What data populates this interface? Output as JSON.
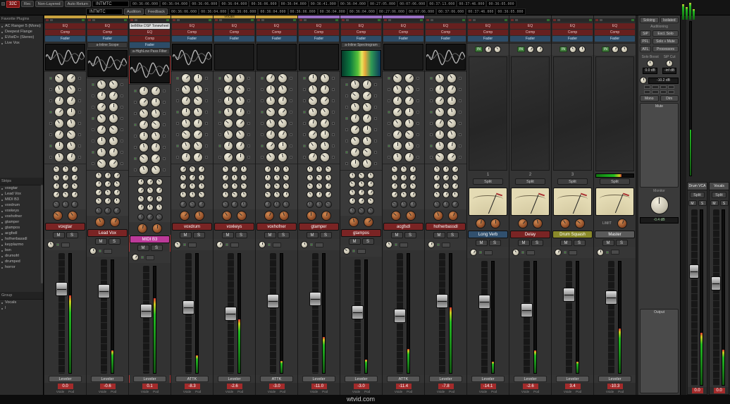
{
  "watermark": "wtvid.com",
  "topbar": {
    "logo": "32C",
    "rec": "Rec",
    "layer_mode": "Non-Layered",
    "auto_return": "Auto Return",
    "display1": "INTMTC",
    "display2": "INTMTC",
    "audition": "Audition",
    "feedback": "Feedback",
    "timecodes_row1": [
      "00:36:06.000",
      "00:36:04.000",
      "00:36:06.000",
      "00:36:04.000",
      "00:36:06.000",
      "00:36:04.000",
      "00:36:41.000",
      "00:36:04.000",
      "00:27:05.000",
      "00:07:06.000",
      "00:37:13.000",
      "00:37:46.000",
      "00:36:05.000"
    ],
    "timecodes_row2": [
      "00:36:06.000",
      "00:36:04.000",
      "00:36:06.000",
      "00:36:04.000",
      "00:36:06.000",
      "00:36:04.000",
      "00:36:04.000",
      "00:27:06.000",
      "00:07:06.000",
      "00:37:06.000",
      "00:37:46.000",
      "00:36:05.000"
    ]
  },
  "sidebar": {
    "plugins_title": "Favorite Plugins",
    "plugins": [
      "AC Ranger 5 (Mono)",
      "Deepest Flange",
      "EVistD+ (Stereo)",
      "Live Vox"
    ],
    "strips_title": "Strips",
    "strip_items": [
      "voxgtar",
      "Lead Vox",
      "MIDI B3",
      "voxdrum",
      "voxkeys",
      "voxhofner",
      "gtamper",
      "gtampos",
      "acgfsdl",
      "hofnerbassdl",
      "keyplazmo",
      "bsn",
      "drumofrl",
      "drumped",
      "horror"
    ],
    "groups_title": "Group",
    "group_items": [
      "Vocals",
      "I"
    ]
  },
  "group_label": "Vocals",
  "labels": {
    "mute": "M",
    "solo": "S",
    "split": "Split",
    "in": "IN",
    "limit": "LIMIT",
    "meta1": "Vside",
    "meta2": "Pod"
  },
  "strips": [
    {
      "name": "voxgtar",
      "type": "channel",
      "tab": "#c9a23f",
      "name_bg": "#7a2424",
      "slots": [
        {
          "label": "EQ",
          "kind": "red"
        },
        {
          "label": "Comp",
          "kind": "red"
        },
        {
          "label": "Fader",
          "kind": "blue"
        }
      ],
      "display": "waveform",
      "btn": "Leveler",
      "value": "0.0",
      "fader": 0.3,
      "meter": 0.65
    },
    {
      "name": "Lead Vox",
      "type": "channel",
      "tab": "#c9a23f",
      "name_bg": "#7a2424",
      "slots": [
        {
          "label": "EQ",
          "kind": "red"
        },
        {
          "label": "Comp",
          "kind": "red"
        },
        {
          "label": "Fader",
          "kind": "blue"
        },
        {
          "label": "a-Inline Scope",
          "kind": "plain"
        }
      ],
      "display": "waveform",
      "btn": "Leveler",
      "value": "-0.6",
      "fader": 0.28,
      "meter": 0.2
    },
    {
      "name": "MIDI B3",
      "type": "channel",
      "selected": true,
      "tab": "#c9a23f",
      "name_bg": "#bc3a9a",
      "slots": [
        {
          "label": "belMike DSP Tonewheel",
          "kind": "white"
        },
        {
          "label": "EQ",
          "kind": "red"
        },
        {
          "label": "Comp",
          "kind": "red"
        },
        {
          "label": "Fader",
          "kind": "blue"
        },
        {
          "label": "a-HighLow Pass Filter",
          "kind": "plain"
        }
      ],
      "display": "waveform",
      "btn": "Leveler",
      "value": "0.1",
      "fader": 0.42,
      "meter": 0.7
    },
    {
      "name": "voxdrum",
      "type": "channel",
      "tab": "#c9a23f",
      "name_bg": "#7a2424",
      "slots": [
        {
          "label": "EQ",
          "kind": "red"
        },
        {
          "label": "Comp",
          "kind": "red"
        },
        {
          "label": "Fader",
          "kind": "blue"
        }
      ],
      "display": "waveform",
      "btn": "ATTK",
      "value": "-8.3",
      "fader": 0.45,
      "meter": 0.15
    },
    {
      "name": "voxkeys",
      "type": "channel",
      "tab": "#c9a23f",
      "name_bg": "#7a2424",
      "slots": [
        {
          "label": "EQ",
          "kind": "red"
        },
        {
          "label": "Comp",
          "kind": "red"
        },
        {
          "label": "Fader",
          "kind": "blue"
        }
      ],
      "display": "dark",
      "btn": "Leveler",
      "value": "-2.6",
      "fader": 0.5,
      "meter": 0.45
    },
    {
      "name": "voxhofner",
      "type": "channel",
      "tab": "#c9a23f",
      "name_bg": "#7a2424",
      "slots": [
        {
          "label": "EQ",
          "kind": "red"
        },
        {
          "label": "Comp",
          "kind": "red"
        },
        {
          "label": "Fader",
          "kind": "blue"
        }
      ],
      "display": "dark",
      "btn": "ATTK",
      "value": "-3.0",
      "fader": 0.4,
      "meter": 0.1
    },
    {
      "name": "gtamper",
      "type": "channel",
      "tab": "#9a70c4",
      "name_bg": "#7a2424",
      "slots": [
        {
          "label": "EQ",
          "kind": "red"
        },
        {
          "label": "Comp",
          "kind": "red"
        },
        {
          "label": "Fader",
          "kind": "blue"
        }
      ],
      "display": "dark",
      "btn": "Leveler",
      "value": "-11.0",
      "fader": 0.38,
      "meter": 0.3
    },
    {
      "name": "gtampos",
      "type": "channel",
      "tab": "#9a70c4",
      "name_bg": "#7a2424",
      "slots": [
        {
          "label": "EQ",
          "kind": "red"
        },
        {
          "label": "Comp",
          "kind": "red"
        },
        {
          "label": "Fader",
          "kind": "blue"
        },
        {
          "label": "a-Inline Spectrogram",
          "kind": "plain"
        }
      ],
      "display": "spectro",
      "btn": "Leveler",
      "value": "-3.0",
      "fader": 0.46,
      "meter": 0.12
    },
    {
      "name": "acgfsdl",
      "type": "channel",
      "tab": "#9a70c4",
      "name_bg": "#7a2424",
      "slots": [
        {
          "label": "EQ",
          "kind": "red"
        },
        {
          "label": "Comp",
          "kind": "red"
        },
        {
          "label": "Fader",
          "kind": "blue"
        }
      ],
      "display": "dark",
      "btn": "ATTK",
      "value": "-11.4",
      "fader": 0.52,
      "meter": 0.2
    },
    {
      "name": "hofnerbassdl",
      "type": "channel",
      "tab": "#3a3a3a",
      "name_bg": "#7a2424",
      "slots": [
        {
          "label": "EQ",
          "kind": "red"
        },
        {
          "label": "Comp",
          "kind": "red"
        },
        {
          "label": "Fader",
          "kind": "blue"
        }
      ],
      "display": "waveform",
      "btn": "Leveler",
      "value": "-7.8",
      "fader": 0.4,
      "meter": 0.55
    },
    {
      "name": "Long Verb",
      "type": "bus",
      "num": "1",
      "tab": "#3a3a3a",
      "name_bg": "#31506e",
      "slots": [
        {
          "label": "EQ",
          "kind": "red"
        },
        {
          "label": "Comp",
          "kind": "red"
        },
        {
          "label": "Fader",
          "kind": "blue"
        }
      ],
      "btn": "Leveler",
      "value": "-14.1",
      "fader": 0.36,
      "meter": 0.1
    },
    {
      "name": "Delay",
      "type": "bus",
      "num": "2",
      "tab": "#3a3a3a",
      "name_bg": "#7a2424",
      "slots": [
        {
          "label": "EQ",
          "kind": "red"
        },
        {
          "label": "Comp",
          "kind": "red"
        },
        {
          "label": "Fader",
          "kind": "blue"
        }
      ],
      "btn": "Leveler",
      "value": "-2.6",
      "fader": 0.44,
      "meter": 0.2
    },
    {
      "name": "Drum Squash",
      "type": "bus",
      "num": "3",
      "tab": "#3a3a3a",
      "name_bg": "#8a8a2a",
      "slots": [
        {
          "label": "EQ",
          "kind": "red"
        },
        {
          "label": "Comp",
          "kind": "red"
        },
        {
          "label": "Fader",
          "kind": "blue"
        }
      ],
      "btn": "Leveler",
      "value": "3.4",
      "fader": 0.3,
      "meter": 0.1
    },
    {
      "name": "Master",
      "type": "master",
      "tab": "#3a3a3a",
      "name_bg": "#5a5a5a",
      "slots": [
        {
          "label": "EQ",
          "kind": "red"
        },
        {
          "label": "Comp",
          "kind": "red"
        },
        {
          "label": "Fader",
          "kind": "blue"
        }
      ],
      "btn": "Leveler",
      "value": "-10.3",
      "fader": 0.33,
      "meter": 0.4
    }
  ],
  "monitor": {
    "soloing": "Soloing",
    "isolated": "Isolated",
    "auditioning": "Auditioning",
    "rows": [
      {
        "btn": "SiP",
        "label": "Excl. Solo"
      },
      {
        "btn": "PFL",
        "label": "Solo » Mute"
      },
      {
        "btn": "AFL",
        "label": "Processors"
      }
    ],
    "solo_boost_label": "Solo Boost",
    "solo_boost_value": "0.0 dB",
    "sip_cut_label": "SiP Cut",
    "sip_cut_value": "-inf dB",
    "dim_label": "Dim",
    "dim_value": "-10.2 dB",
    "mono": "Mono",
    "mute": "Mute",
    "knob_label": "Monitor",
    "level": "-0.4 dB",
    "output": "Output"
  },
  "vca": [
    {
      "name": "Drum VCA",
      "split": "Split",
      "value": "0.0",
      "fader": 0.35,
      "meter": 0.3
    },
    {
      "name": "Vocals",
      "split": "Split",
      "value": "0.0",
      "fader": 0.42,
      "meter": 0.2
    }
  ]
}
